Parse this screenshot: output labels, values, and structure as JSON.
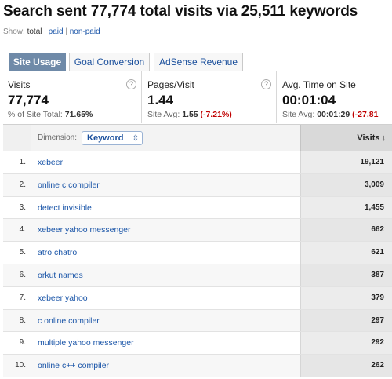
{
  "header": {
    "title": "Search sent 77,774 total visits via 25,511 keywords"
  },
  "filter": {
    "label": "Show:",
    "options": [
      "total",
      "paid",
      "non-paid"
    ],
    "separator": "|",
    "active": "total"
  },
  "tabs": [
    {
      "label": "Site Usage",
      "active": true
    },
    {
      "label": "Goal Conversion",
      "active": false
    },
    {
      "label": "AdSense Revenue",
      "active": false
    }
  ],
  "metrics": [
    {
      "label": "Visits",
      "value": "77,774",
      "sub_prefix": "% of Site Total:",
      "sub_value": "71.65%",
      "sub_delta": ""
    },
    {
      "label": "Pages/Visit",
      "value": "1.44",
      "sub_prefix": "Site Avg:",
      "sub_value": "1.55",
      "sub_delta": "(-7.21%)"
    },
    {
      "label": "Avg. Time on Site",
      "value": "00:01:04",
      "sub_prefix": "Site Avg:",
      "sub_value": "00:01:29",
      "sub_delta": "(-27.81"
    }
  ],
  "help_glyph": "?",
  "table": {
    "dimension_label": "Dimension:",
    "dimension_value": "Keyword",
    "dimension_chevron": "⇳",
    "visits_header": "Visits",
    "sort_glyph": "↓",
    "rows": [
      {
        "num": "1.",
        "keyword": "xebeer",
        "visits": "19,121"
      },
      {
        "num": "2.",
        "keyword": "online c compiler",
        "visits": "3,009"
      },
      {
        "num": "3.",
        "keyword": "detect invisible",
        "visits": "1,455"
      },
      {
        "num": "4.",
        "keyword": "xebeer yahoo messenger",
        "visits": "662"
      },
      {
        "num": "5.",
        "keyword": "atro chatro",
        "visits": "621"
      },
      {
        "num": "6.",
        "keyword": "orkut names",
        "visits": "387"
      },
      {
        "num": "7.",
        "keyword": "xebeer yahoo",
        "visits": "379"
      },
      {
        "num": "8.",
        "keyword": "c online compiler",
        "visits": "297"
      },
      {
        "num": "9.",
        "keyword": "multiple yahoo messenger",
        "visits": "292"
      },
      {
        "num": "10.",
        "keyword": "online c++ compiler",
        "visits": "262"
      }
    ]
  },
  "colors": {
    "active_tab": "#6f8aa8",
    "link": "#1a55a8",
    "negative": "#c00000"
  }
}
